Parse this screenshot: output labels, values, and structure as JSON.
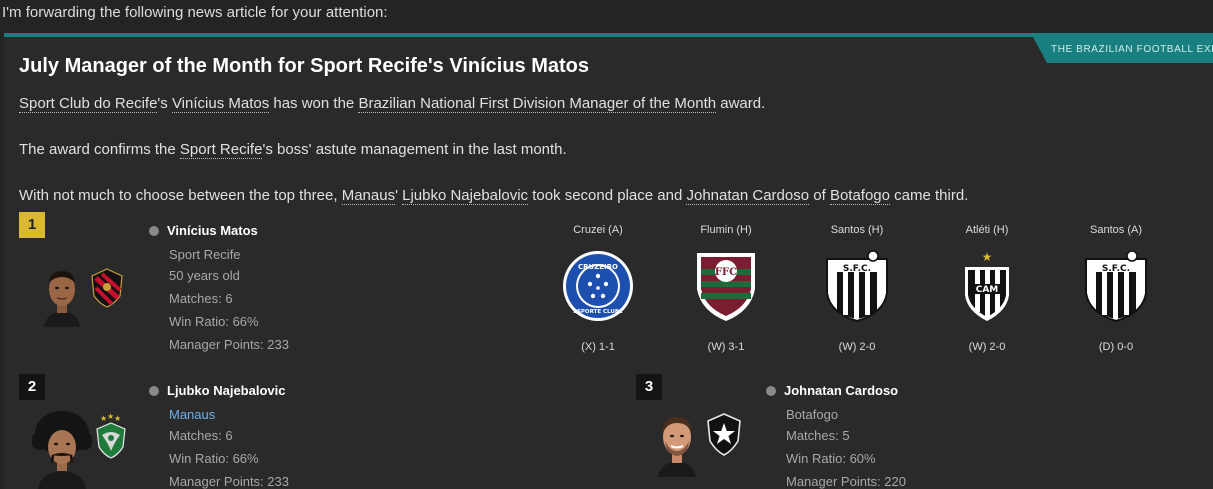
{
  "intro": "I'm forwarding the following news article for your attention:",
  "tag": "THE BRAZILIAN FOOTBALL EXP",
  "headline": "July Manager of the Month for Sport Recife's Vinícius Matos",
  "para1": {
    "club": "Sport Club do Recife",
    "s1": "'s ",
    "manager": "Vinícius Matos",
    "s2": " has won the ",
    "award": "Brazilian National First Division Manager of the Month",
    "s3": " award."
  },
  "para2": {
    "s1": "The award confirms the ",
    "club": "Sport Recife",
    "s2": "'s boss' astute management in the last month."
  },
  "para3": {
    "s1": "With not much to choose between the top three, ",
    "club2": "Manaus",
    "s2": "' ",
    "manager2": "Ljubko Najebalovic",
    "s3": " took second place and ",
    "manager3": "Johnatan Cardoso",
    "s4": " of ",
    "club3": "Botafogo",
    "s5": " came third."
  },
  "first": {
    "rank": "1",
    "name": "Vinícius Matos",
    "club": "Sport Recife",
    "age": "50 years old",
    "matches": "Matches: 6",
    "win_ratio": "Win Ratio: 66%",
    "points": "Manager Points: 233",
    "rank_color": "#d8b92f"
  },
  "second": {
    "rank": "2",
    "name": "Ljubko Najebalovic",
    "club": "Manaus",
    "matches": "Matches: 6",
    "win_ratio": "Win Ratio: 66%",
    "points": "Manager Points: 233",
    "club_color": "#6fb0ea"
  },
  "third": {
    "rank": "3",
    "name": "Johnatan Cardoso",
    "club": "Botafogo",
    "matches": "Matches: 5",
    "win_ratio": "Win Ratio: 60%",
    "points": "Manager Points: 220"
  },
  "fixtures": [
    {
      "opponent": "Cruzei (A)",
      "result": "(X) 1-1",
      "crest": "cruzeiro-crest-icon"
    },
    {
      "opponent": "Flumin (H)",
      "result": "(W) 3-1",
      "crest": "fluminense-crest-icon"
    },
    {
      "opponent": "Santos (H)",
      "result": "(W) 2-0",
      "crest": "santos-crest-icon"
    },
    {
      "opponent": "Atléti (H)",
      "result": "(W) 2-0",
      "crest": "atletico-crest-icon"
    },
    {
      "opponent": "Santos (A)",
      "result": "(D) 0-0",
      "crest": "santos-crest-icon"
    }
  ],
  "crest_labels": {
    "cruzeiro_top": "CRUZEIRO",
    "cruzeiro_bottom": "ESPORTE CLUBE",
    "santos": "S.F.C.",
    "atletico": "CAM"
  },
  "accent_color": "#1a7f80"
}
